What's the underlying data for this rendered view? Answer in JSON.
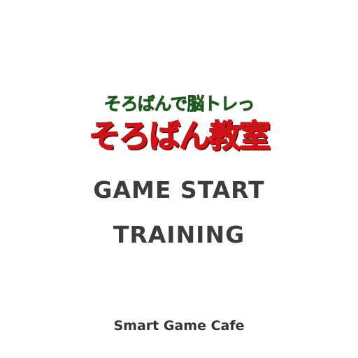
{
  "logo": {
    "subtitle": "そろばんで脳トレっ",
    "title": "そろばん教室"
  },
  "menu": {
    "game_start": "GAME START",
    "training": "TRAINING"
  },
  "footer": {
    "brand": "Smart Game Cafe"
  },
  "colors": {
    "subtitle": "#1f5a1e",
    "title": "#d11317",
    "menu_text": "#3c3c3c",
    "background": "#ffffff"
  }
}
